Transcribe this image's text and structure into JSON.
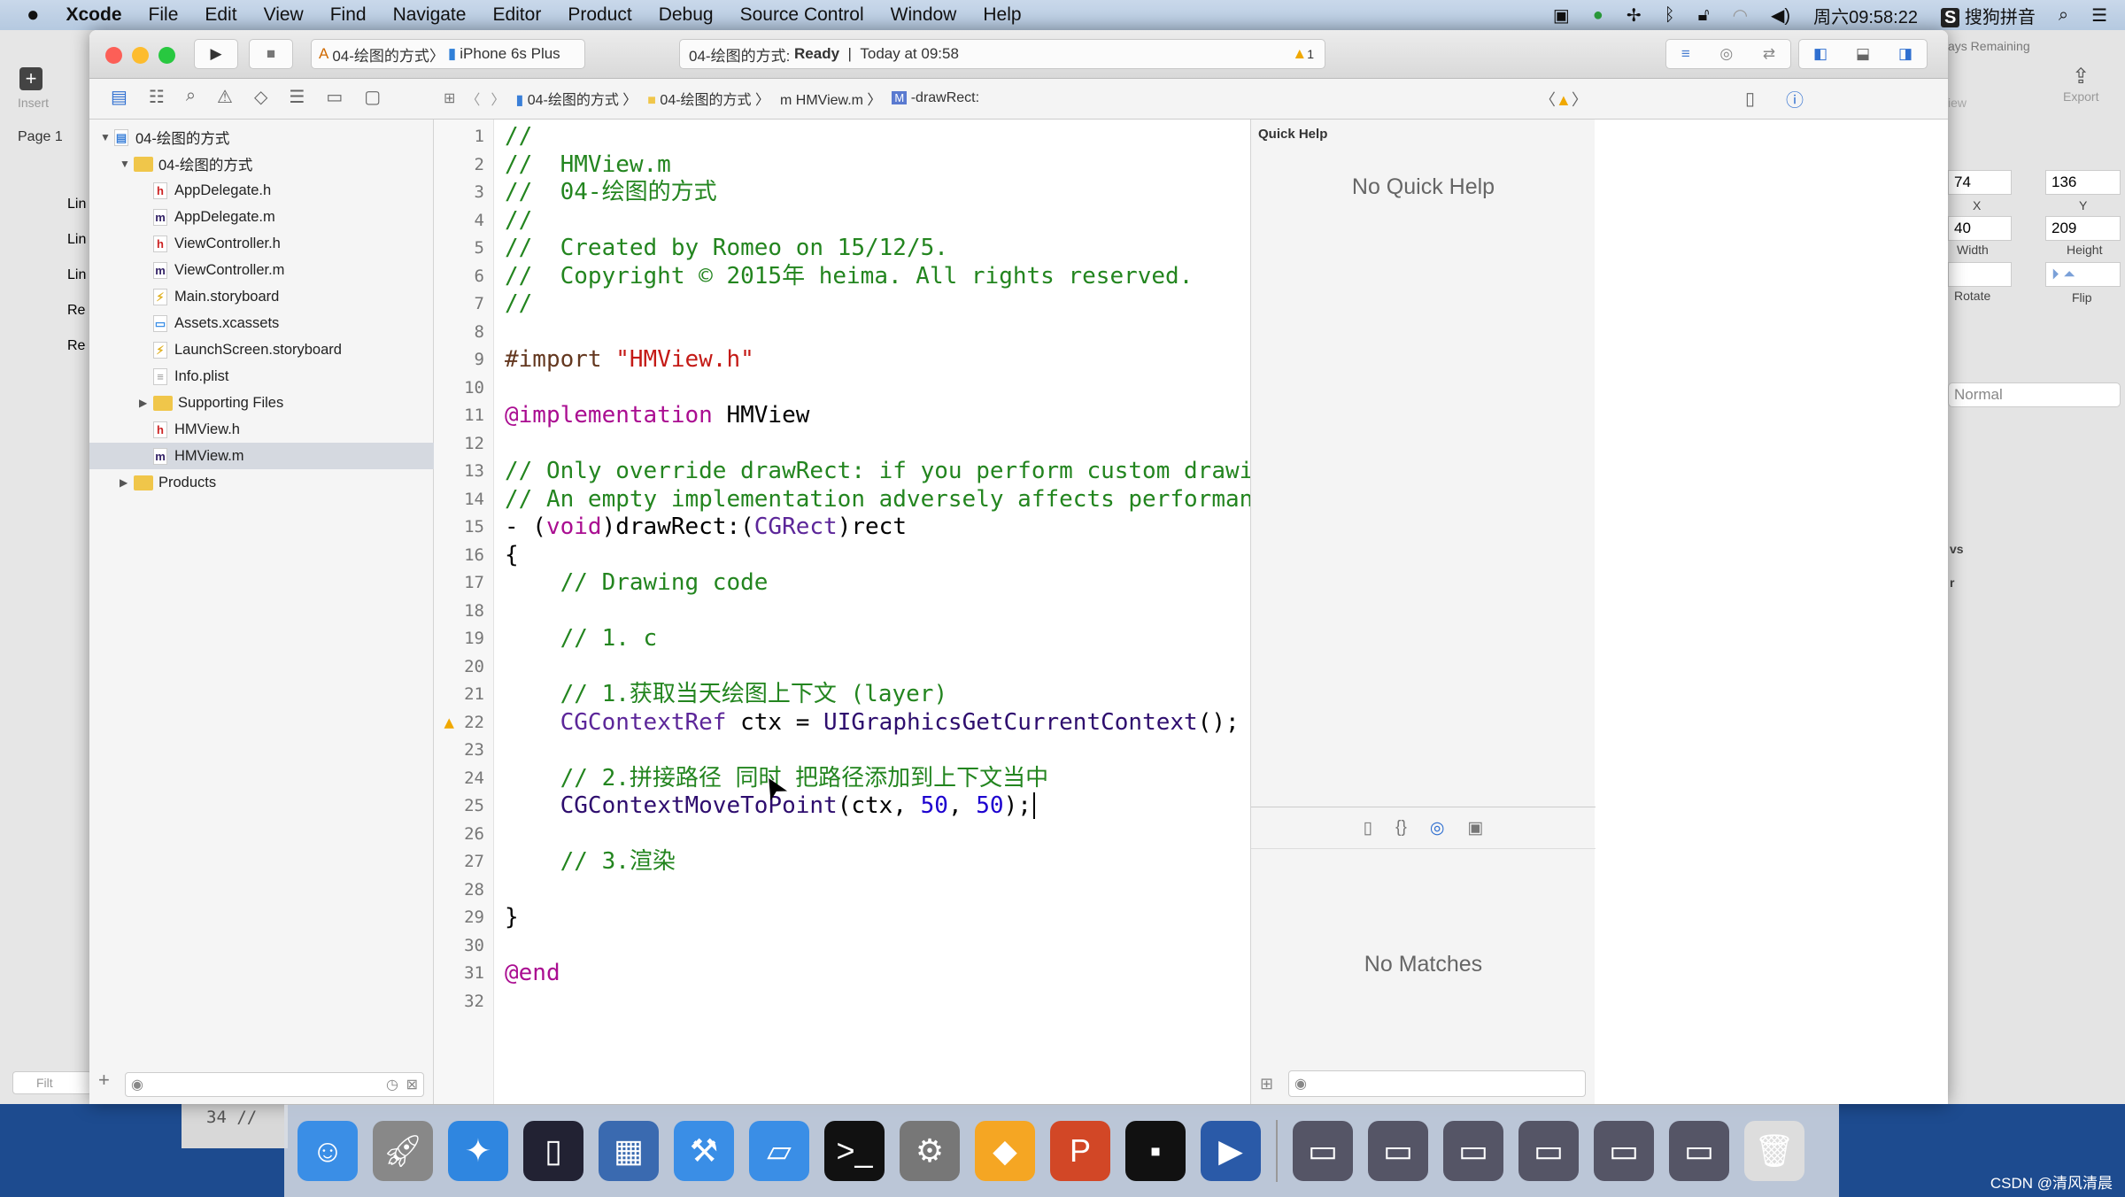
{
  "menubar": {
    "apple": "",
    "items": [
      "Xcode",
      "File",
      "Edit",
      "View",
      "Find",
      "Navigate",
      "Editor",
      "Product",
      "Debug",
      "Source Control",
      "Window",
      "Help"
    ],
    "clock": "周六09:58:22",
    "ime": "搜狗拼音"
  },
  "toolbar": {
    "scheme": "04-绘图的方式",
    "device": "iPhone 6s Plus",
    "activity_project": "04-绘图的方式:",
    "activity_status": "Ready",
    "activity_time": "Today at 09:58",
    "warning_count": "1"
  },
  "jumpbar": [
    "04-绘图的方式",
    "04-绘图的方式",
    "HMView.m",
    "-drawRect:"
  ],
  "navigator": {
    "items": [
      {
        "label": "04-绘图的方式",
        "kind": "project",
        "level": 0,
        "open": true
      },
      {
        "label": "04-绘图的方式",
        "kind": "folder",
        "level": 1,
        "open": true
      },
      {
        "label": "AppDelegate.h",
        "kind": "h",
        "level": 2
      },
      {
        "label": "AppDelegate.m",
        "kind": "m",
        "level": 2
      },
      {
        "label": "ViewController.h",
        "kind": "h",
        "level": 2
      },
      {
        "label": "ViewController.m",
        "kind": "m",
        "level": 2
      },
      {
        "label": "Main.storyboard",
        "kind": "sb",
        "level": 2
      },
      {
        "label": "Assets.xcassets",
        "kind": "assets",
        "level": 2
      },
      {
        "label": "LaunchScreen.storyboard",
        "kind": "sb",
        "level": 2
      },
      {
        "label": "Info.plist",
        "kind": "plist",
        "level": 2
      },
      {
        "label": "Supporting Files",
        "kind": "folder",
        "level": 2,
        "open": false
      },
      {
        "label": "HMView.h",
        "kind": "h",
        "level": 2
      },
      {
        "label": "HMView.m",
        "kind": "m",
        "level": 2,
        "selected": true
      },
      {
        "label": "Products",
        "kind": "folder",
        "level": 1,
        "open": false
      }
    ]
  },
  "editor": {
    "warning_line": 22,
    "lines": [
      [
        [
          "//",
          "comment"
        ]
      ],
      [
        [
          "//  HMView.m",
          "comment"
        ]
      ],
      [
        [
          "//  04-绘图的方式",
          "comment"
        ]
      ],
      [
        [
          "//",
          "comment"
        ]
      ],
      [
        [
          "//  Created by Romeo on 15/12/5.",
          "comment"
        ]
      ],
      [
        [
          "//  Copyright © 2015年 heima. All rights reserved.",
          "comment"
        ]
      ],
      [
        [
          "//",
          "comment"
        ]
      ],
      [],
      [
        [
          "#import ",
          "pre"
        ],
        [
          "\"HMView.h\"",
          "str"
        ]
      ],
      [],
      [
        [
          "@implementation",
          "kw"
        ],
        [
          " HMView",
          "plain"
        ]
      ],
      [],
      [
        [
          "// Only override drawRect: if you perform custom drawing.",
          "comment"
        ]
      ],
      [
        [
          "// An empty implementation adversely affects performance during animation.",
          "comment"
        ]
      ],
      [
        [
          "- (",
          "plain"
        ],
        [
          "void",
          "kw"
        ],
        [
          ")drawRect:(",
          "plain"
        ],
        [
          "CGRect",
          "type"
        ],
        [
          ")rect",
          "plain"
        ]
      ],
      [
        [
          "{",
          "plain"
        ]
      ],
      [
        [
          "    // Drawing code",
          "comment"
        ]
      ],
      [],
      [
        [
          "    // 1. c",
          "comment"
        ]
      ],
      [],
      [
        [
          "    // 1.获取当天绘图上下文 (layer)",
          "comment"
        ]
      ],
      [
        [
          "    ",
          "plain"
        ],
        [
          "CGContextRef",
          "type"
        ],
        [
          " ctx = ",
          "plain"
        ],
        [
          "UIGraphicsGetCurrentContext",
          "fn"
        ],
        [
          "();",
          "plain"
        ]
      ],
      [],
      [
        [
          "    // 2.拼接路径 同时 把路径添加到上下文当中",
          "comment"
        ]
      ],
      [
        [
          "    ",
          "plain"
        ],
        [
          "CGContextMoveToPoint",
          "fn"
        ],
        [
          "(ctx, ",
          "plain"
        ],
        [
          "50",
          "num"
        ],
        [
          ", ",
          "plain"
        ],
        [
          "50",
          "num"
        ],
        [
          ");",
          "plain"
        ]
      ],
      [],
      [
        [
          "    // 3.渲染",
          "comment"
        ]
      ],
      [],
      [
        [
          "}",
          "plain"
        ]
      ],
      [],
      [
        [
          "@end",
          "kw"
        ]
      ],
      []
    ]
  },
  "inspector": {
    "quick_help_title": "Quick Help",
    "quick_help_empty": "No Quick Help",
    "library_empty": "No Matches"
  },
  "background_app": {
    "insert_label": "Insert",
    "page_label": "Page 1",
    "layers": [
      "Lin",
      "Lin",
      "Lin",
      "Re",
      "Re"
    ],
    "filter": "Filt",
    "trial": "ays Remaining",
    "view_label": "iew",
    "export_label": "Export",
    "x": "74",
    "x_label": "X",
    "y": "136",
    "y_label": "Y",
    "width": "40",
    "width_label": "Width",
    "height": "209",
    "height_label": "Height",
    "rotate_label": "Rotate",
    "flip_label": "Flip",
    "blend": "Normal",
    "section": "vs",
    "sel": "r"
  },
  "behind_numbers": "34 //",
  "dock": [
    "finder",
    "launchpad",
    "safari",
    "mouse",
    "photo-slideshow",
    "xcode",
    "xcode-simulator",
    "terminal",
    "system-preferences",
    "sketch",
    "powerpoint",
    "console",
    "quicktime",
    "screen1",
    "screen2",
    "screen3",
    "screen4",
    "screen5",
    "screen6",
    "trash"
  ],
  "watermark": "CSDN @清风清晨",
  "colors": {
    "comment": "#23851f",
    "keyword": "#aa0d91",
    "string": "#c41a16",
    "type": "#5c2699",
    "number": "#1c00cf",
    "selection": "#d5d9e0"
  }
}
